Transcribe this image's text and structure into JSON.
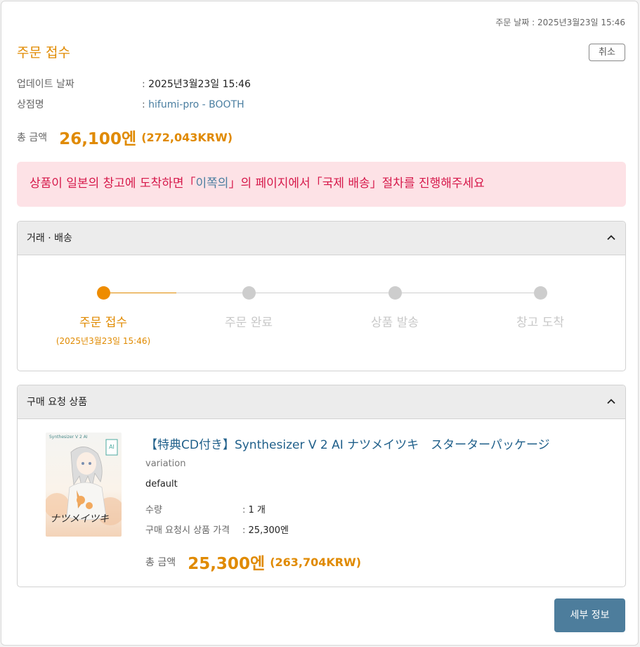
{
  "header": {
    "order_date_text": "주문 날짜 : 2025년3월23일 15:46",
    "title": "주문 접수",
    "cancel_label": "취소"
  },
  "info": {
    "update_label": "업데이트 날짜",
    "update_value": "2025년3월23일 15:46",
    "shop_label": "상점명",
    "shop_value": "hifumi-pro - BOOTH",
    "colon": ":"
  },
  "total": {
    "label": "총 금액",
    "price": "26,100엔",
    "krw": "(272,043KRW)"
  },
  "notice": {
    "part1": "상품이 일본의 창고에 도착하면「",
    "link": "이쪽의",
    "part2": "」의 페이지에서「국제 배송」절차를 진행해주세요"
  },
  "shipping_panel": {
    "title": "거래 · 배송",
    "steps": [
      {
        "label": "주문 접수",
        "date": "(2025년3월23일 15:46)",
        "active": true
      },
      {
        "label": "주문 완료",
        "active": false
      },
      {
        "label": "상품 발송",
        "active": false
      },
      {
        "label": "창고 도착",
        "active": false
      }
    ]
  },
  "item_panel": {
    "title": "구매 요청 상품",
    "product_title": "【特典CD付き】Synthesizer V 2 AI ナツメイツキ　スターターパッケージ",
    "variation_label": "variation",
    "variation_value": "default",
    "qty_label": "수량",
    "qty_value": "1 개",
    "price_label": "구매 요청시 상품 가격",
    "price_value": "25,300엔",
    "total_label": "총 금액",
    "total_price": "25,300엔",
    "total_krw": "(263,704KRW)",
    "image_text": "Synthesizer V 2 AI",
    "image_logo": "ナツメイツキ"
  },
  "footer": {
    "detail_label": "세부 정보"
  },
  "colors": {
    "accent": "#e08a00",
    "link": "#4a7ea0",
    "notice_bg": "#fde2e6",
    "notice_text": "#d6184a",
    "button": "#4d7d9c"
  }
}
